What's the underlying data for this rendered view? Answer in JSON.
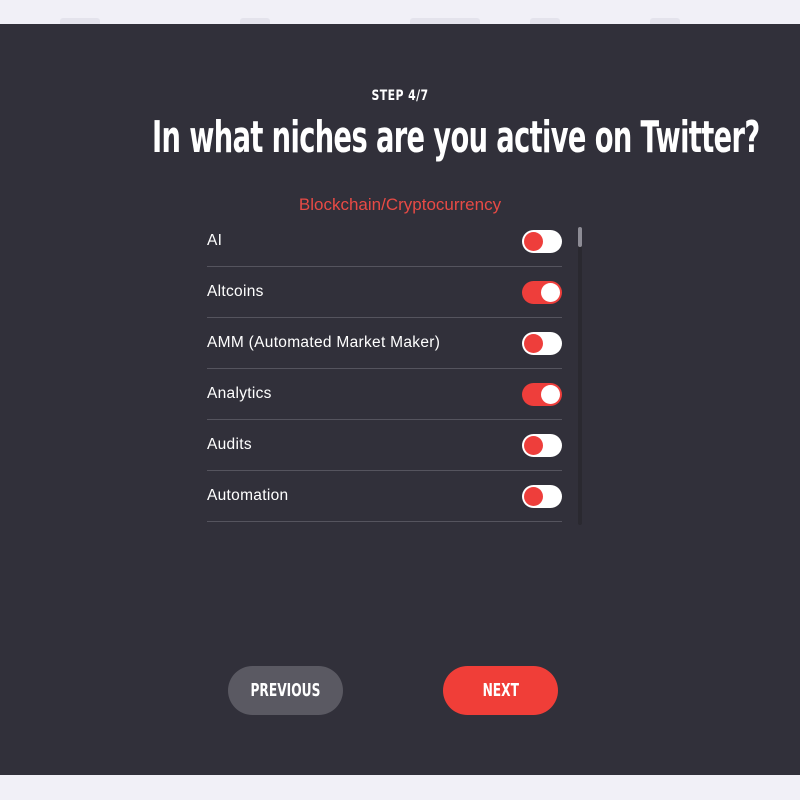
{
  "header": {
    "step": "STEP 4/7",
    "title": "In what niches are you active on Twitter?"
  },
  "category": "Blockchain/Cryptocurrency",
  "niches": [
    {
      "label": "AI",
      "enabled": false
    },
    {
      "label": "Altcoins",
      "enabled": true
    },
    {
      "label": "AMM (Automated Market Maker)",
      "enabled": false
    },
    {
      "label": "Analytics",
      "enabled": true
    },
    {
      "label": "Audits",
      "enabled": false
    },
    {
      "label": "Automation",
      "enabled": false
    }
  ],
  "nav": {
    "previous_label": "PREVIOUS",
    "next_label": "NEXT"
  },
  "colors": {
    "background": "#31303a",
    "accent": "#ee3e3b",
    "secondary_button": "#5a5962"
  }
}
